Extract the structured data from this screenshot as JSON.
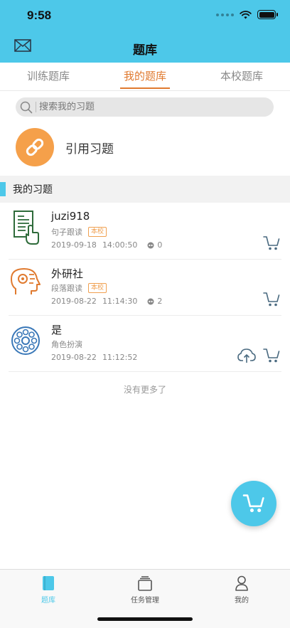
{
  "status_bar": {
    "time": "9:58"
  },
  "header": {
    "title": "题库"
  },
  "tabs": [
    {
      "label": "训练题库",
      "active": false
    },
    {
      "label": "我的题库",
      "active": true
    },
    {
      "label": "本校题库",
      "active": false
    }
  ],
  "search": {
    "placeholder": "搜索我的习题"
  },
  "quote": {
    "label": "引用习题"
  },
  "section": {
    "title": "我的习题"
  },
  "items": [
    {
      "name": "juzi918",
      "type": "句子跟读",
      "badge": "本校",
      "date": "2019-09-18",
      "time": "14:00:50",
      "views": "0",
      "icon": "document-hand-icon"
    },
    {
      "name": "外研社",
      "type": "段落跟读",
      "badge": "本校",
      "date": "2019-08-22",
      "time": "11:14:30",
      "views": "2",
      "icon": "head-gears-icon"
    },
    {
      "name": "是",
      "type": "角色扮演",
      "date": "2019-08-22",
      "time": "11:12:52",
      "icon": "film-reel-icon"
    }
  ],
  "no_more": "没有更多了",
  "bottom_nav": [
    {
      "label": "题库",
      "icon": "book-icon",
      "active": true
    },
    {
      "label": "任务管理",
      "icon": "stack-icon",
      "active": false
    },
    {
      "label": "我的",
      "icon": "person-icon",
      "active": false
    }
  ],
  "colors": {
    "primary": "#4dc8e9",
    "accent": "#e07a2f",
    "quote_bg": "#f5a04a"
  }
}
